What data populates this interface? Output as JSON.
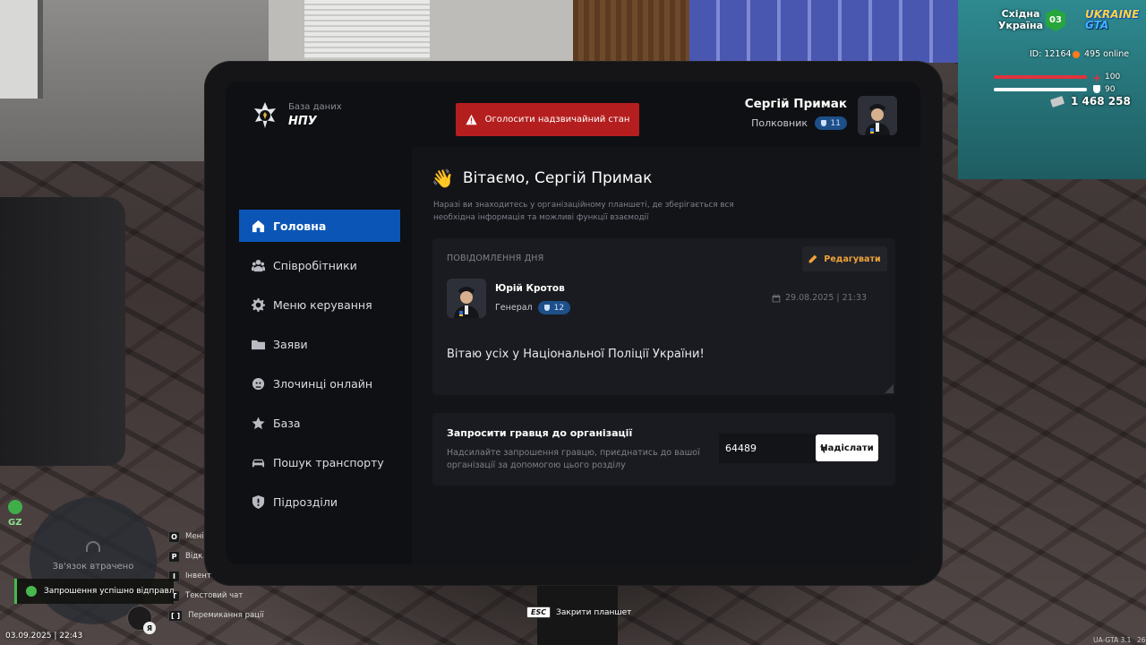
{
  "app": {
    "logo_subtitle": "База даних",
    "logo_title": "НПУ"
  },
  "emergency_button": "Оголосити надзвичайний стан",
  "user": {
    "name": "Сергій Примак",
    "rank": "Полковник",
    "level": "11"
  },
  "sidebar": {
    "items": [
      {
        "label": "Головна",
        "icon": "home-icon",
        "active": true
      },
      {
        "label": "Співробітники",
        "icon": "users-icon"
      },
      {
        "label": "Меню керування",
        "icon": "gear-icon"
      },
      {
        "label": "Заяви",
        "icon": "folder-icon"
      },
      {
        "label": "Злочинці онлайн",
        "icon": "mask-icon"
      },
      {
        "label": "База",
        "icon": "star-icon"
      },
      {
        "label": "Пошук транспорту",
        "icon": "car-icon"
      },
      {
        "label": "Підрозділи",
        "icon": "shield-icon"
      }
    ]
  },
  "welcome": {
    "title": "Вітаємо, Сергій Примак",
    "text": "Наразі ви знаходитесь у організаційному планшеті, де зберігається вся необхідна інформація та можливі функції взаємодії"
  },
  "motd": {
    "title": "ПОВІДОМЛЕННЯ ДНЯ",
    "edit_label": "Редагувати",
    "author_name": "Юрій Кротов",
    "author_rank": "Генерал",
    "author_level": "12",
    "date": "29.08.2025 | 21:33",
    "message": "Вітаю усіх у Національної Поліції України!"
  },
  "invite": {
    "title": "Запросити гравця до організації",
    "description": "Надсилайте запрошення гравцю, приєднатись до вашої організації за допомогою цього розділу",
    "input_value": "64489",
    "send_label": "Надіслати"
  },
  "hud": {
    "region_line1": "Східна",
    "region_line2": "Україна",
    "region_badge": "03",
    "logo_line1": "UKRAINE",
    "logo_line2": "GTA",
    "player_id": "ID: 12164",
    "online": "495 online",
    "health": "100",
    "armor": "90",
    "money": "1 468 258",
    "zone": "GZ",
    "minimap_text": "Зв'язок втрачено",
    "toast": "Запрошення успішно відправлене",
    "keys": [
      {
        "key": "O",
        "label": "Мені"
      },
      {
        "key": "P",
        "label": "Відк"
      },
      {
        "key": "I",
        "label": "Інвент"
      },
      {
        "key": "T",
        "label": "Текстовий чат"
      },
      {
        "key": "[ ]",
        "label": "Перемикання рації"
      }
    ],
    "mic_badge": "Я",
    "datetime": "03.09.2025 | 22:43",
    "esc_key": "ESC",
    "esc_label": "Закрити планшет",
    "version": "UA-GTA 3.1",
    "version_suffix": "26"
  },
  "colors": {
    "accent": "#0b55b7",
    "emergency": "#b51e1e",
    "edit": "#f0a43a",
    "health": "#e0333c",
    "success": "#48b84e"
  }
}
